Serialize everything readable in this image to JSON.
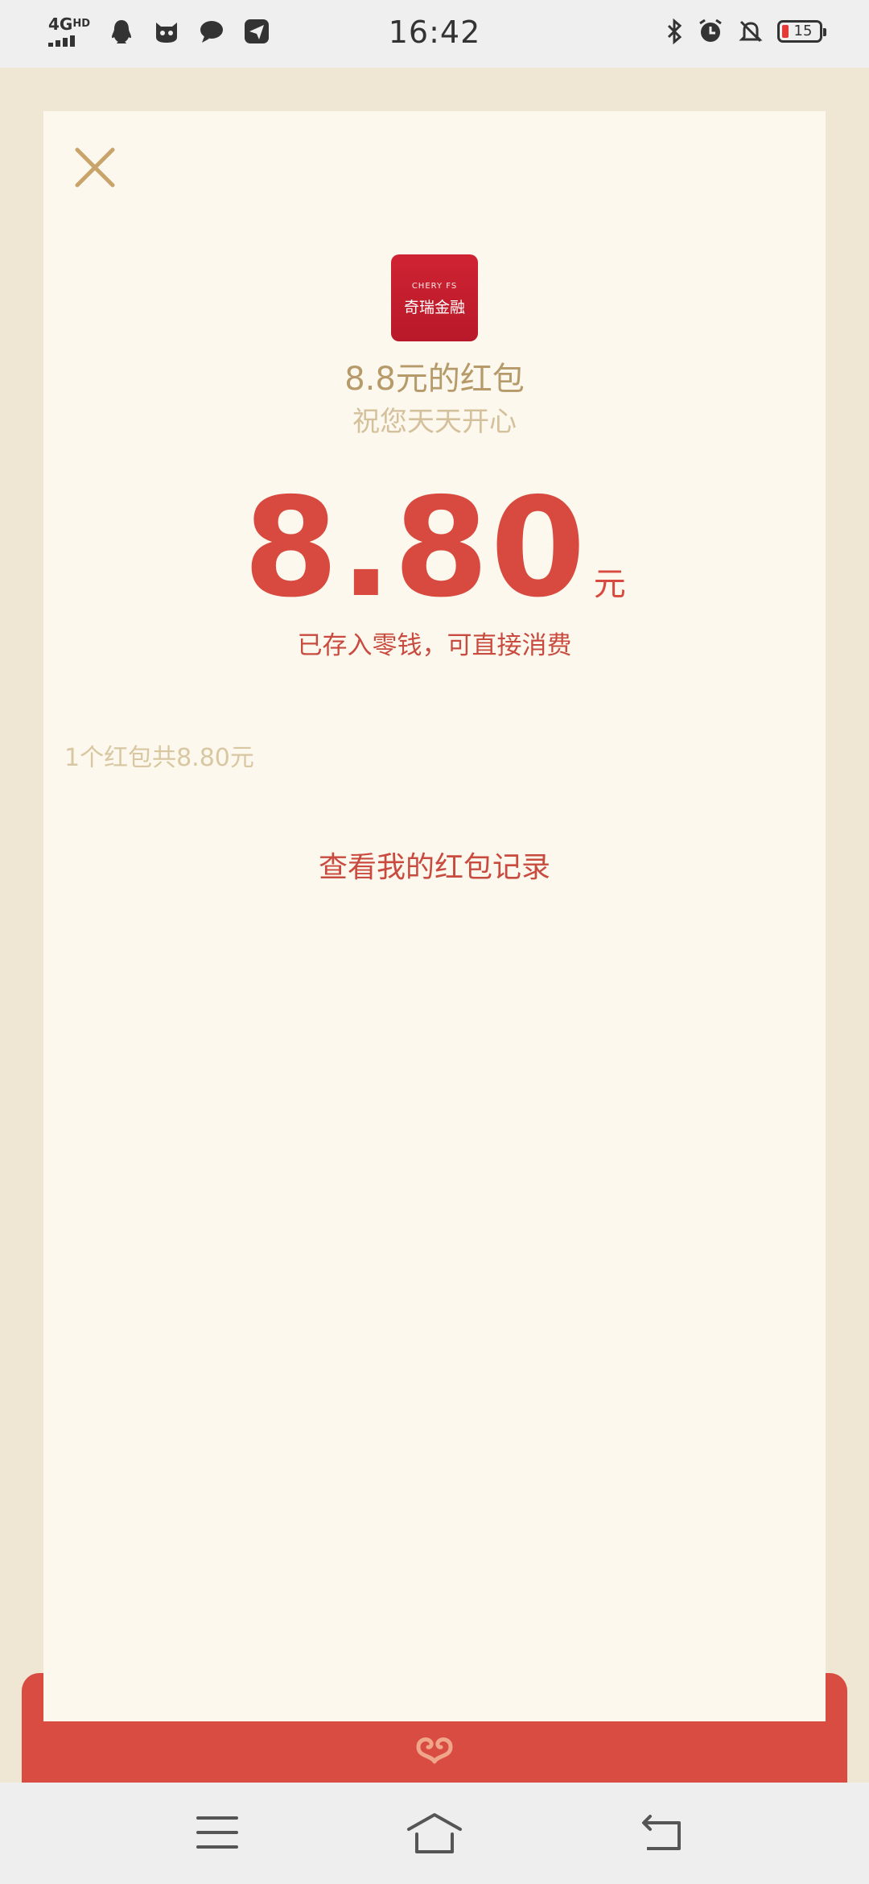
{
  "status_bar": {
    "network": "4G",
    "network_sup": "HD",
    "time": "16:42",
    "battery": "15",
    "icons": [
      "qq-icon",
      "cat-app-icon",
      "chat-bubble-icon",
      "send-icon",
      "bluetooth-icon",
      "alarm-icon",
      "mute-icon",
      "battery-icon"
    ]
  },
  "card": {
    "logo_en": "CHERY FS",
    "logo_cn": "奇瑞金融",
    "title": "8.8元的红包",
    "wish": "祝您天天开心",
    "amount": "8.80",
    "unit": "元",
    "stored_note": "已存入零钱，可直接消费",
    "summary": "1个红包共8.80元",
    "record_link": "查看我的红包记录"
  },
  "colors": {
    "accent_red": "#d84a3f",
    "gold": "#b69a6a",
    "card_bg": "#fcf8ee",
    "page_bg": "#efe6d3"
  },
  "navbar": {
    "icons": [
      "menu-icon",
      "home-icon",
      "back-icon"
    ]
  }
}
